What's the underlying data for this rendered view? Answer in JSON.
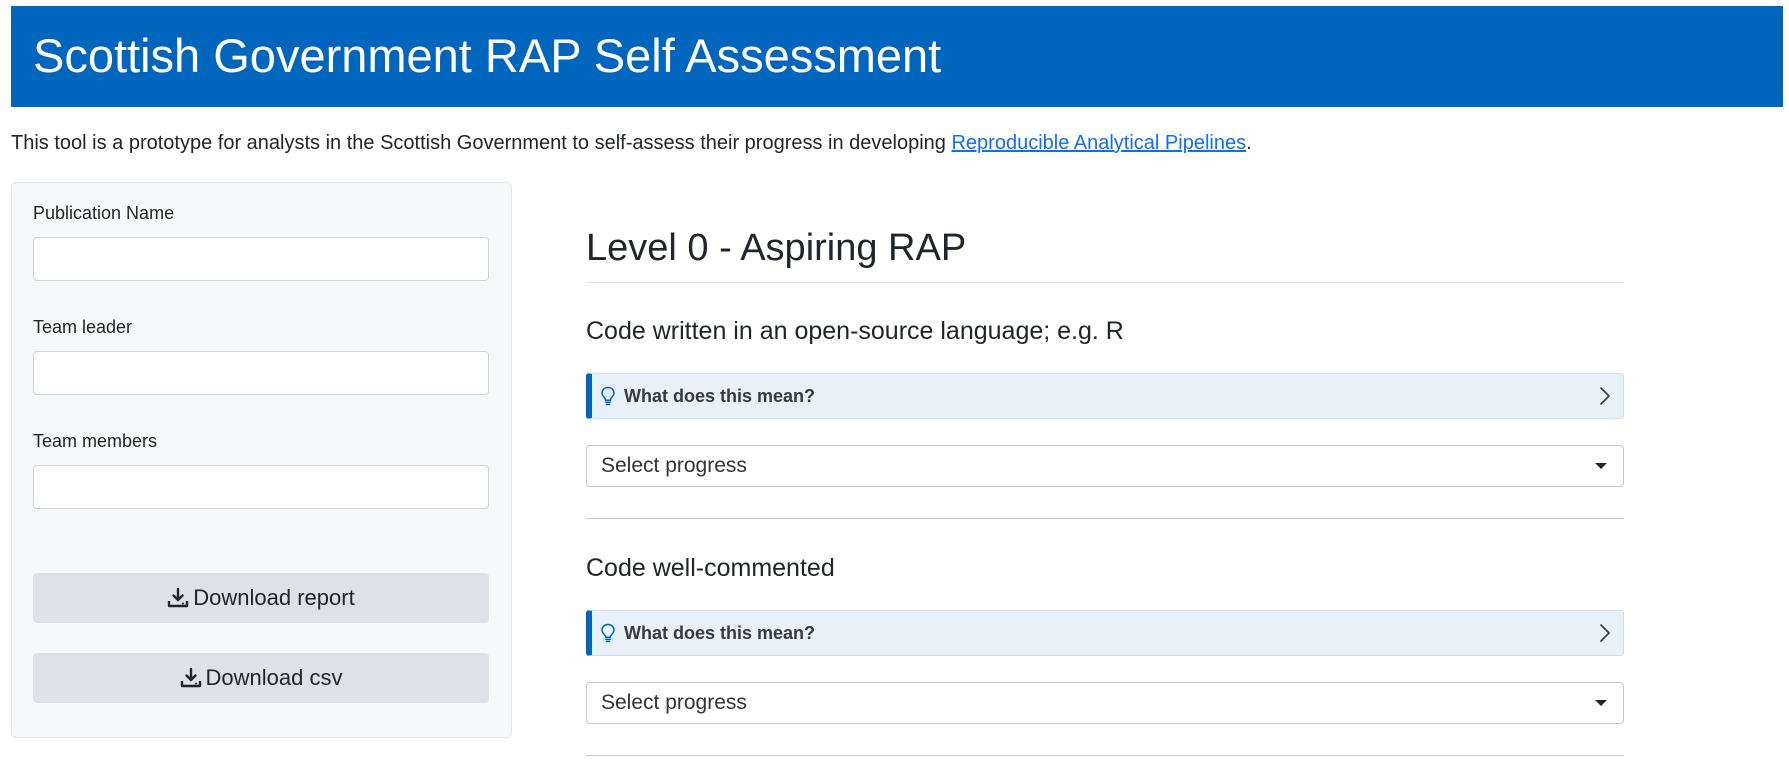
{
  "header": {
    "title": "Scottish Government RAP Self Assessment"
  },
  "intro": {
    "text": "This tool is a prototype for analysts in the Scottish Government to self-assess their progress in developing ",
    "link_text": "Reproducible Analytical Pipelines",
    "suffix": "."
  },
  "sidebar": {
    "fields": [
      {
        "label": "Publication Name",
        "value": ""
      },
      {
        "label": "Team leader",
        "value": ""
      },
      {
        "label": "Team members",
        "value": ""
      }
    ],
    "download_report_label": "Download report",
    "download_csv_label": "Download csv",
    "download_icon": "download-icon"
  },
  "main": {
    "level_heading": "Level 0 - Aspiring RAP",
    "questions": [
      {
        "title": "Code written in an open-source language; e.g. R",
        "accordion_label": "What does this mean?",
        "select_value": "Select progress"
      },
      {
        "title": "Code well-commented",
        "accordion_label": "What does this mean?",
        "select_value": "Select progress"
      }
    ]
  },
  "colors": {
    "banner": "#0065bd",
    "accordion_bg": "#e8f0f9",
    "accordion_accent": "#0065bd",
    "button_bg": "#dee1e6",
    "link": "#0d6efd"
  }
}
